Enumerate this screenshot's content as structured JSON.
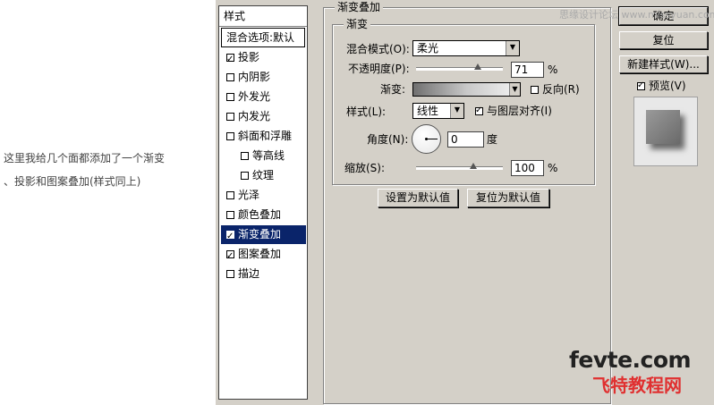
{
  "annotation": {
    "line1": "这里我给几个面都添加了一个渐变",
    "line2": "、投影和图案叠加(样式同上)"
  },
  "style_list": {
    "header": "样式",
    "blend_options": "混合选项:默认",
    "items": [
      {
        "label": "投影",
        "checked": true
      },
      {
        "label": "内阴影",
        "checked": false
      },
      {
        "label": "外发光",
        "checked": false
      },
      {
        "label": "内发光",
        "checked": false
      },
      {
        "label": "斜面和浮雕",
        "checked": false
      },
      {
        "label": "等高线",
        "checked": false
      },
      {
        "label": "纹理",
        "checked": false
      },
      {
        "label": "光泽",
        "checked": false
      },
      {
        "label": "颜色叠加",
        "checked": false
      },
      {
        "label": "渐变叠加",
        "checked": true,
        "selected": true
      },
      {
        "label": "图案叠加",
        "checked": true
      },
      {
        "label": "描边",
        "checked": false
      }
    ]
  },
  "panel": {
    "title": "渐变叠加",
    "group_title": "渐变",
    "blend_mode_label": "混合模式(O):",
    "blend_mode_value": "柔光",
    "opacity_label": "不透明度(P):",
    "opacity_value": "71",
    "opacity_percent": 71,
    "percent_sign": "%",
    "gradient_label": "渐变:",
    "reverse_label": "反向(R)",
    "reverse_checked": false,
    "style_label": "样式(L):",
    "style_value": "线性",
    "align_label": "与图层对齐(I)",
    "align_checked": true,
    "angle_label": "角度(N):",
    "angle_value": "0",
    "angle_unit": "度",
    "scale_label": "缩放(S):",
    "scale_value": "100",
    "scale_percent": 100,
    "scale_percent_sign": "%",
    "make_default": "设置为默认值",
    "reset_default": "复位为默认值"
  },
  "right": {
    "ok_label": "确定",
    "reset_label": "复位",
    "new_style_label": "新建样式(W)...",
    "preview_label": "预览(V)",
    "preview_checked": true
  },
  "watermark": "思缘设计论坛 www.missyuan.com",
  "logo": {
    "line1": "fevte.com",
    "line2": "飞特教程网"
  }
}
